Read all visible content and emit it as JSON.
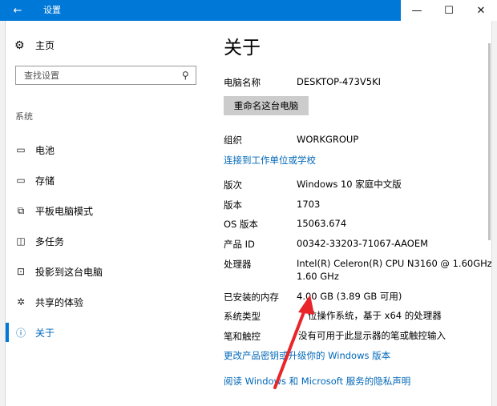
{
  "window": {
    "title": "设置",
    "back_icon": "←",
    "minimize_icon": "—",
    "maximize_icon": "☐",
    "close_icon": "✕"
  },
  "sidebar": {
    "home": {
      "label": "主页",
      "icon": "⚙"
    },
    "search_placeholder": "查找设置",
    "search_icon": "⚲",
    "section_title": "系统",
    "items": [
      {
        "label": "电池",
        "icon": "▭"
      },
      {
        "label": "存储",
        "icon": "▭"
      },
      {
        "label": "平板电脑模式",
        "icon": "⧉"
      },
      {
        "label": "多任务",
        "icon": "◫"
      },
      {
        "label": "投影到这台电脑",
        "icon": "⊡"
      },
      {
        "label": "共享的体验",
        "icon": "✲"
      },
      {
        "label": "关于",
        "icon": "ⓘ",
        "selected": true
      }
    ]
  },
  "about": {
    "title": "关于",
    "pc_name_label": "电脑名称",
    "pc_name_value": "DESKTOP-473V5KI",
    "rename_button": "重命名这台电脑",
    "org_label": "组织",
    "org_value": "WORKGROUP",
    "connect_link": "连接到工作单位或学校",
    "edition_label": "版次",
    "edition_value": "Windows 10 家庭中文版",
    "version_label": "版本",
    "version_value": "1703",
    "os_build_label": "OS 版本",
    "os_build_value": "15063.674",
    "product_id_label": "产品 ID",
    "product_id_value": "00342-33203-71067-AAOEM",
    "processor_label": "处理器",
    "processor_value_line1": "Intel(R) Celeron(R) CPU  N3160  @ 1.60GHz",
    "processor_value_line2": "1.60 GHz",
    "ram_label": "已安装的内存",
    "ram_value": "4.00 GB (3.89 GB 可用)",
    "system_type_label": "系统类型",
    "system_type_value": "位操作系统，基于 x64 的处理器",
    "pen_touch_label": "笔和触控",
    "pen_touch_value": "没有可用于此显示器的笔或触控输入",
    "product_key_link": "更改产品密钥或升级你的 Windows 版本",
    "privacy_link": "阅读 Windows 和 Microsoft 服务的隐私声明"
  },
  "annotation": {
    "arrow_color": "#e8262a"
  }
}
